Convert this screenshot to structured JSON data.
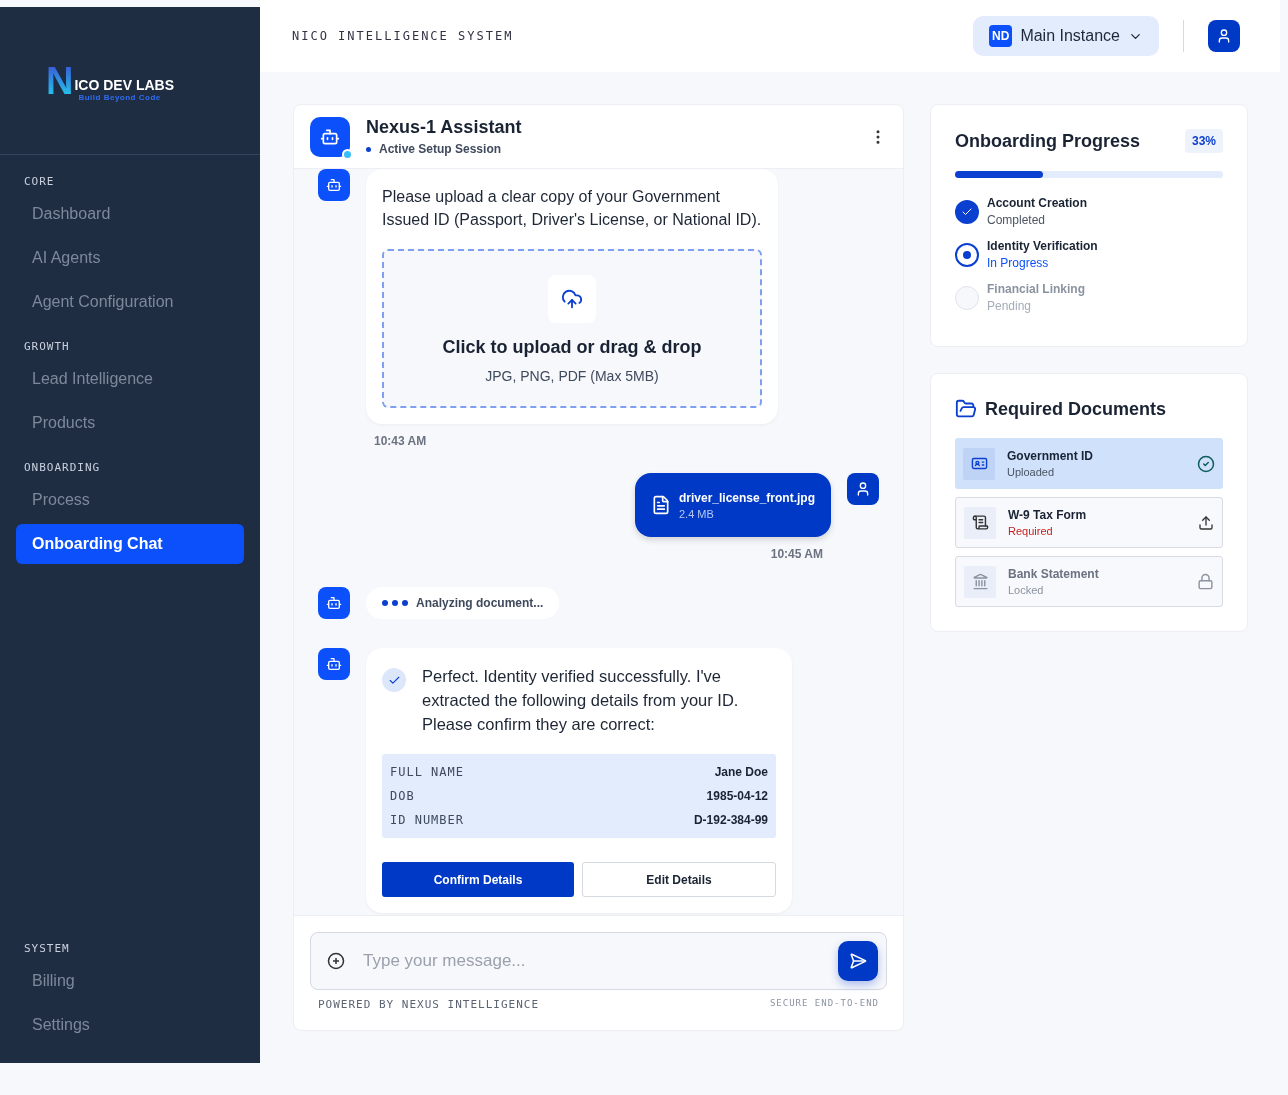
{
  "sidebar": {
    "logo": {
      "letter": "N",
      "name": "ICO DEV LABS",
      "tagline": "Build Beyond Code"
    },
    "sections": [
      {
        "title": "CORE",
        "items": [
          {
            "label": "Dashboard",
            "selected": false
          },
          {
            "label": "AI Agents",
            "selected": false
          },
          {
            "label": "Agent Configuration",
            "selected": false
          }
        ]
      },
      {
        "title": "GROWTH",
        "items": [
          {
            "label": "Lead Intelligence",
            "selected": false
          },
          {
            "label": "Products",
            "selected": false
          }
        ]
      },
      {
        "title": "ONBOARDING",
        "items": [
          {
            "label": "Process",
            "selected": false
          },
          {
            "label": "Onboarding Chat",
            "selected": true
          }
        ]
      },
      {
        "title": "SYSTEM",
        "items": [
          {
            "label": "Billing",
            "selected": false
          },
          {
            "label": "Settings",
            "selected": false
          }
        ]
      }
    ]
  },
  "header": {
    "title": "NICO INTELLIGENCE SYSTEM",
    "instance": {
      "badge": "ND",
      "label": "Main Instance"
    }
  },
  "chat": {
    "title": "Nexus-1 Assistant",
    "status": "Active Setup Session",
    "messages": [
      {
        "kind": "upload_request",
        "text": "Please upload a clear copy of your Government Issued ID (Passport, Driver's License, or National ID).",
        "drop_title": "Click to upload or drag & drop",
        "drop_hint": "JPG, PNG, PDF (Max 5MB)",
        "time": "10:43 AM"
      },
      {
        "kind": "file",
        "name": "driver_license_front.jpg",
        "size": "2.4 MB",
        "time": "10:45 AM"
      },
      {
        "kind": "typing",
        "text": "Analyzing document..."
      },
      {
        "kind": "details",
        "text": "Perfect. Identity verified successfully. I've extracted the following details from your ID. Please confirm they are correct:",
        "fields": [
          {
            "label": "FULL NAME",
            "value": "Jane Doe"
          },
          {
            "label": "DOB",
            "value": "1985-04-12"
          },
          {
            "label": "ID NUMBER",
            "value": "D-192-384-99"
          }
        ],
        "confirm": "Confirm Details",
        "edit": "Edit Details"
      }
    ],
    "input": {
      "placeholder": "Type your message..."
    },
    "footer_left": "POWERED BY NEXUS INTELLIGENCE",
    "footer_right": "SECURE END-TO-END"
  },
  "progress": {
    "title": "Onboarding Progress",
    "percent": "33%",
    "level": 0.33,
    "steps": [
      {
        "kind": "completed",
        "title": "Account Creation",
        "status": "Completed"
      },
      {
        "kind": "in_progress",
        "title": "Identity Verification",
        "status": "In Progress"
      },
      {
        "kind": "pending",
        "title": "Financial Linking",
        "status": "Pending"
      }
    ]
  },
  "documents": {
    "title": "Required Documents",
    "items": [
      {
        "kind": "uploaded",
        "name": "Government ID",
        "status": "Uploaded"
      },
      {
        "kind": "required",
        "name": "W-9 Tax Form",
        "status": "Required"
      },
      {
        "kind": "locked",
        "name": "Bank Statement",
        "status": "Locked"
      }
    ]
  }
}
